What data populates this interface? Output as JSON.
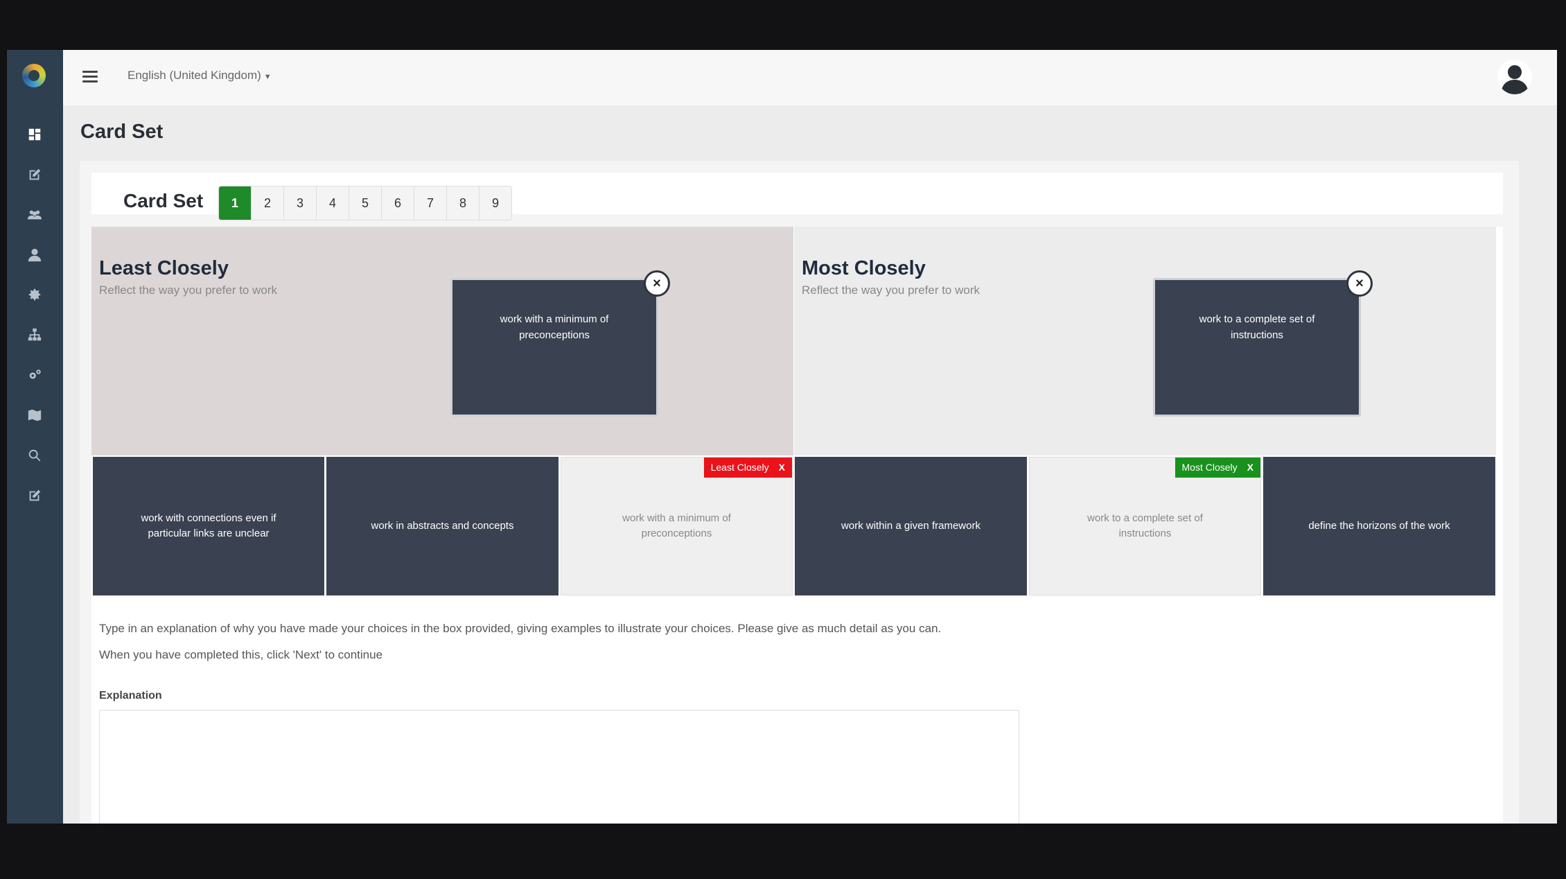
{
  "topbar": {
    "language": "English (United Kingdom)"
  },
  "sidebar": {
    "items": [
      {
        "icon": "dashboard-icon",
        "active": true
      },
      {
        "icon": "edit-icon"
      },
      {
        "icon": "users-icon"
      },
      {
        "icon": "user-icon"
      },
      {
        "icon": "gear-icon"
      },
      {
        "icon": "hierarchy-icon"
      },
      {
        "icon": "cogs-icon"
      },
      {
        "icon": "map-icon"
      },
      {
        "icon": "search-icon"
      },
      {
        "icon": "edit-icon"
      }
    ]
  },
  "page": {
    "title": "Card Set"
  },
  "card_set": {
    "label": "Card Set",
    "pages": [
      "1",
      "2",
      "3",
      "4",
      "5",
      "6",
      "7",
      "8",
      "9"
    ],
    "active_page": "1"
  },
  "least_zone": {
    "title": "Least Closely",
    "subtitle": "Reflect the way you prefer to work",
    "card": "work with a minimum of preconceptions",
    "remove_label": "×"
  },
  "most_zone": {
    "title": "Most Closely",
    "subtitle": "Reflect the way you prefer to work",
    "card": "work to a complete set of instructions",
    "remove_label": "×"
  },
  "cards": [
    {
      "text": "work with connections even if particular links are unclear",
      "state": "available"
    },
    {
      "text": "work in abstracts and concepts",
      "state": "available"
    },
    {
      "text": "work with a minimum of preconceptions",
      "state": "placed",
      "tag": "Least Closely",
      "tag_x": "X"
    },
    {
      "text": "work within a given framework",
      "state": "available"
    },
    {
      "text": "work to a complete set of instructions",
      "state": "placed",
      "tag": "Most Closely",
      "tag_x": "X"
    },
    {
      "text": "define the horizons of the work",
      "state": "available"
    }
  ],
  "instructions": {
    "line1": "Type in an explanation of why you have made your choices in the box provided, giving examples to illustrate your choices. Please give as much detail as you can.",
    "line2": "When you have completed this, click 'Next' to continue"
  },
  "explanation": {
    "label": "Explanation",
    "value": ""
  },
  "colors": {
    "sidebar": "#2e3f4f",
    "card_dark": "#3a4150",
    "active_page": "#1e8a2a",
    "least_tag": "#e8131b",
    "most_tag": "#19911d"
  }
}
